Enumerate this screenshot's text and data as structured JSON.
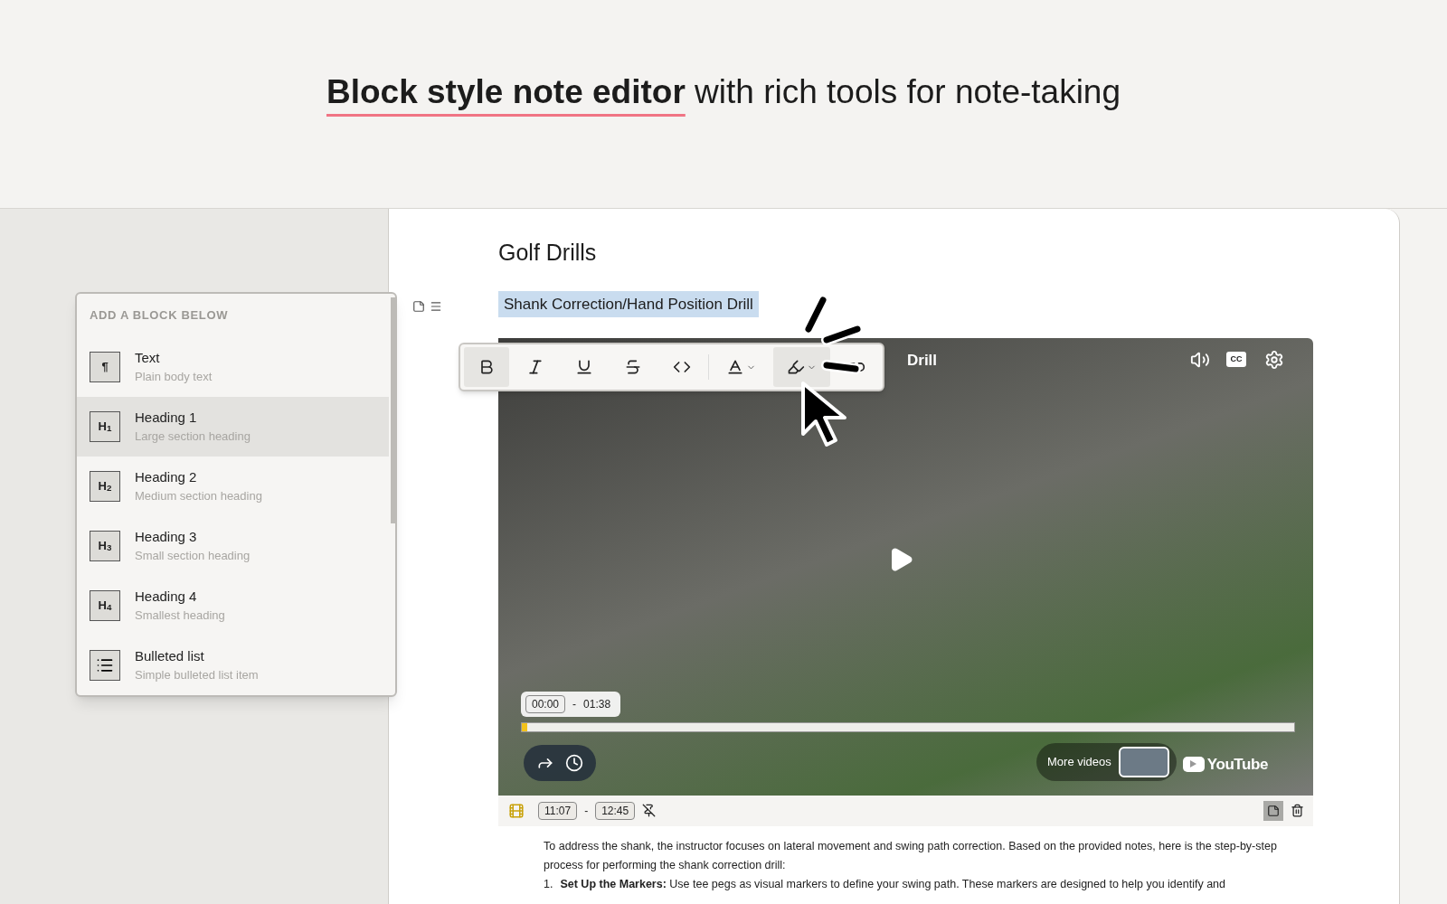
{
  "headline": "**Block style note editor** with rich tools for note-taking",
  "note": {
    "title": "Golf Drills",
    "selected_heading": "Shank Correction/Hand Position Drill"
  },
  "block_menu": {
    "heading": "ADD A BLOCK BELOW",
    "items": [
      {
        "kind": "glyph",
        "badge": "¶",
        "label": "Text",
        "description": "Plain body text",
        "selected": false
      },
      {
        "kind": "glyph",
        "badge": "H$_{1}$",
        "label": "Heading 1",
        "description": "Large section heading",
        "selected": true
      },
      {
        "kind": "glyph",
        "badge": "H$_{2}$",
        "label": "Heading 2",
        "description": "Medium section heading",
        "selected": false
      },
      {
        "kind": "glyph",
        "badge": "H$_{3}$",
        "label": "Heading 3",
        "description": "Small section heading",
        "selected": false
      },
      {
        "kind": "glyph",
        "badge": "H$_{4}$",
        "label": "Heading 4",
        "description": "Smallest heading",
        "selected": false
      },
      {
        "kind": "list",
        "label": "Bulleted list",
        "description": "Simple bulleted list item",
        "selected": false
      }
    ]
  },
  "format_toolbar": [
    {
      "kind": "bold",
      "active": true
    },
    {
      "kind": "italic",
      "active": false
    },
    {
      "kind": "underline",
      "active": false
    },
    {
      "kind": "strike",
      "active": false
    },
    {
      "kind": "code",
      "active": false
    },
    {
      "kind": "text-color",
      "active": false
    },
    {
      "kind": "highlight",
      "active": true
    },
    {
      "kind": "link",
      "active": false
    }
  ],
  "video": {
    "title": "Drill",
    "captions": "CC",
    "time_start": "00:00",
    "time_end": "01:38",
    "time_separator": "-",
    "level": 0.005,
    "more_videos": "More videos",
    "logo": "YouTube"
  },
  "clip_bar": {
    "start": "11:07",
    "end": "12:45",
    "separator": "-",
    "note_selected": true
  },
  "body": {
    "paragraph": "To address the shank, the instructor focuses on lateral movement and swing path correction. Based on the provided notes, here is the step-by-step process for performing the shank correction drill:",
    "steps": [
      {
        "number": "1.",
        "text": "**Set Up the Markers:** Use tee pegs as visual markers to define your swing path. These markers are designed to help you identify and"
      }
    ]
  }
}
